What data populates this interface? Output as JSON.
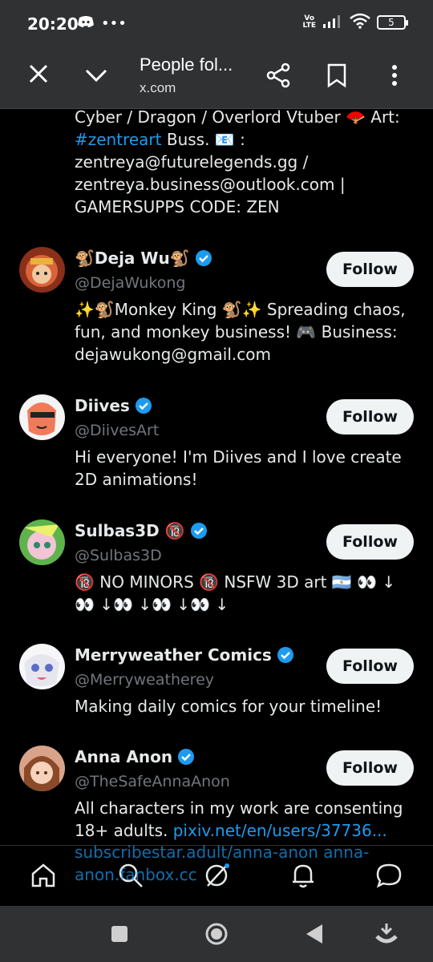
{
  "status": {
    "time": "20:20",
    "volte_top": "Vo",
    "volte_bottom": "LTE",
    "battery": "5"
  },
  "toolbar": {
    "title": "People fol...",
    "url": "x.com"
  },
  "top_bio": {
    "line1": "Cyber / Dragon / Overlord Vtuber 🪭 Art:",
    "link": "#zentreart",
    "after_link": " Buss. 📧 :",
    "line3": "zentreya@futurelegends.gg /",
    "line4": "zentreya.business@outlook.com |",
    "line5": "GAMERSUPPS CODE: ZEN"
  },
  "users": [
    {
      "name": "🐒Deja Wu🐒",
      "handle": "@DejaWukong",
      "bio": "✨🐒Monkey King 🐒✨ Spreading chaos, fun, and monkey business! 🎮 Business: dejawukong@gmail.com",
      "follow": "Follow"
    },
    {
      "name": "Diives",
      "handle": "@DiivesArt",
      "bio": "Hi everyone! I'm Diives and I love create 2D animations!",
      "follow": "Follow"
    },
    {
      "name": "Sulbas3D 🔞",
      "handle": "@Sulbas3D",
      "bio": "🔞 NO MINORS 🔞 NSFW 3D art 🇦🇷 👀 ↓ 👀 ↓👀 ↓👀 ↓👀 ↓",
      "follow": "Follow"
    },
    {
      "name": "Merryweather Comics",
      "handle": "@Merryweatherey",
      "bio": "Making daily comics for your timeline!",
      "follow": "Follow"
    },
    {
      "name": "Anna Anon",
      "handle": "@TheSafeAnnaAnon",
      "bio_start": "All characters in my work are consenting 18+ adults. ",
      "bio_link": "pixiv.net/en/users/37736...",
      "bio_overlay": "subscribestar.adult/anna-anon anna-anon.fanbox.cc",
      "follow": "Follow"
    }
  ],
  "colors": {
    "accent": "#1d9bf0",
    "background": "#000000",
    "follow_bg": "#eff3f4",
    "muted": "#71767b"
  },
  "icons": [
    "home-icon",
    "search-icon",
    "grok-icon",
    "bell-icon",
    "messages-icon"
  ]
}
